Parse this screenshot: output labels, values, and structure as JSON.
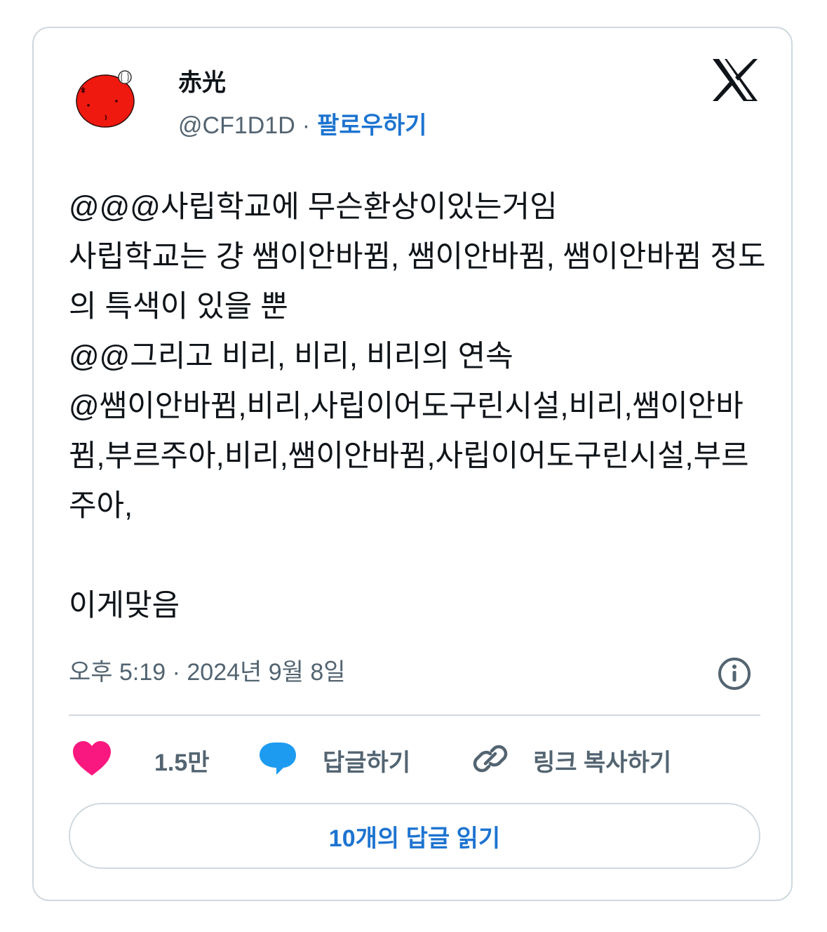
{
  "author": {
    "display_name": "赤光",
    "handle": "@CF1D1D",
    "separator": "·",
    "follow_label": "팔로우하기",
    "avatar_icon": "red-tomato-character-avatar"
  },
  "brand": {
    "logo_icon": "x-logo-icon"
  },
  "tweet": {
    "text": "@@@사립학교에 무슨환상이있는거임\n사립학교는 걍 쌤이안바뀜, 쌤이안바뀜, 쌤이안바뀜 정도의 특색이 있을 뿐\n@@그리고 비리, 비리, 비리의 연속\n@쌤이안바뀜,비리,사립이어도구린시설,비리,쌤이안바뀜,부르주아,비리,쌤이안바뀜,사립이어도구린시설,부르주아,\n\n이게맞음",
    "timestamp": "오후 5:19 · 2024년 9월 8일"
  },
  "actions": {
    "like_count": "1.5만",
    "reply_label": "답글하기",
    "copy_link_label": "링크 복사하기"
  },
  "footer": {
    "read_replies_label": "10개의 답글 읽기"
  },
  "colors": {
    "accent": "#1d74d0",
    "like": "#f91880",
    "reply": "#1d9bf0",
    "muted": "#536471",
    "border": "#cfd9de",
    "avatar_red": "#f0190f"
  }
}
